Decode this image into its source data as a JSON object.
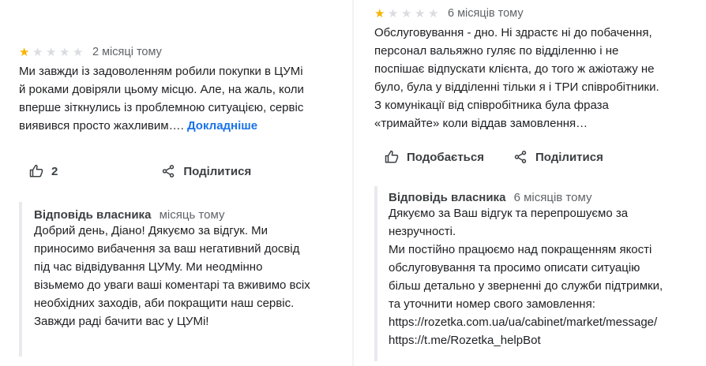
{
  "colors": {
    "star_filled": "#f6b400",
    "star_empty": "#dadce0",
    "link": "#1a73e8",
    "text": "#202124",
    "muted": "#5f6368",
    "reply_border": "#e8eaed"
  },
  "icons": {
    "star": "star-icon",
    "like": "thumbs-up-icon",
    "share": "share-icon"
  },
  "reviews": [
    {
      "rating": 1,
      "max_rating": 5,
      "date": "2 місяці тому",
      "text_lines": [
        "Ми завжди із задоволенням робили покупки в ЦУМі",
        "й роками довіряли цьому місцю. Але, на жаль, коли",
        "вперше зіткнулись із проблемною ситуацією, сервіс",
        "виявився просто жахливим…."
      ],
      "more_label": "Докладніше",
      "like_count": "2",
      "share_label": "Поділитися",
      "reply": {
        "author": "Відповідь власника",
        "date": "місяць тому",
        "lines": [
          "Добрий день, Діано! Дякуємо за відгук. Ми",
          "приносимо вибачення за ваш негативний досвід",
          "під час відвідування ЦУМу. Ми неодмінно",
          "візьмемо до уваги ваші коментарі та вживимо всіх",
          "необхідних заходів, аби покращити наш сервіс.",
          "Завжди раді бачити вас у ЦУМі!"
        ]
      }
    },
    {
      "rating": 1,
      "max_rating": 5,
      "date": "6 місяців тому",
      "text_lines": [
        "Обслуговування - дно. Ні здрастє ні до побачення,",
        "персонал вальяжно гуляє по відділенню і не",
        "поспішає відпускати клієнта, до того ж ажіотажу не",
        "було, була у відділенні тільки я і ТРИ співробітники.",
        "З комунікації від співробітника була фраза",
        "«тримайте» коли віддав замовлення…"
      ],
      "like_label": "Подобається",
      "share_label": "Поділитися",
      "reply": {
        "author": "Відповідь власника",
        "date": "6 місяців тому",
        "lines": [
          "Дякуємо за Ваш відгук та перепрошуємо за",
          "незручності.",
          "Ми постійно працюємо над покращенням якості",
          "обслуговування та просимо описати ситуацію",
          "більш детально у зверненні до служби підтримки,",
          "та уточнити номер свого замовлення:",
          "https://rozetka.com.ua/ua/cabinet/market/message/",
          "https://t.me/Rozetka_helpBot"
        ]
      }
    }
  ]
}
